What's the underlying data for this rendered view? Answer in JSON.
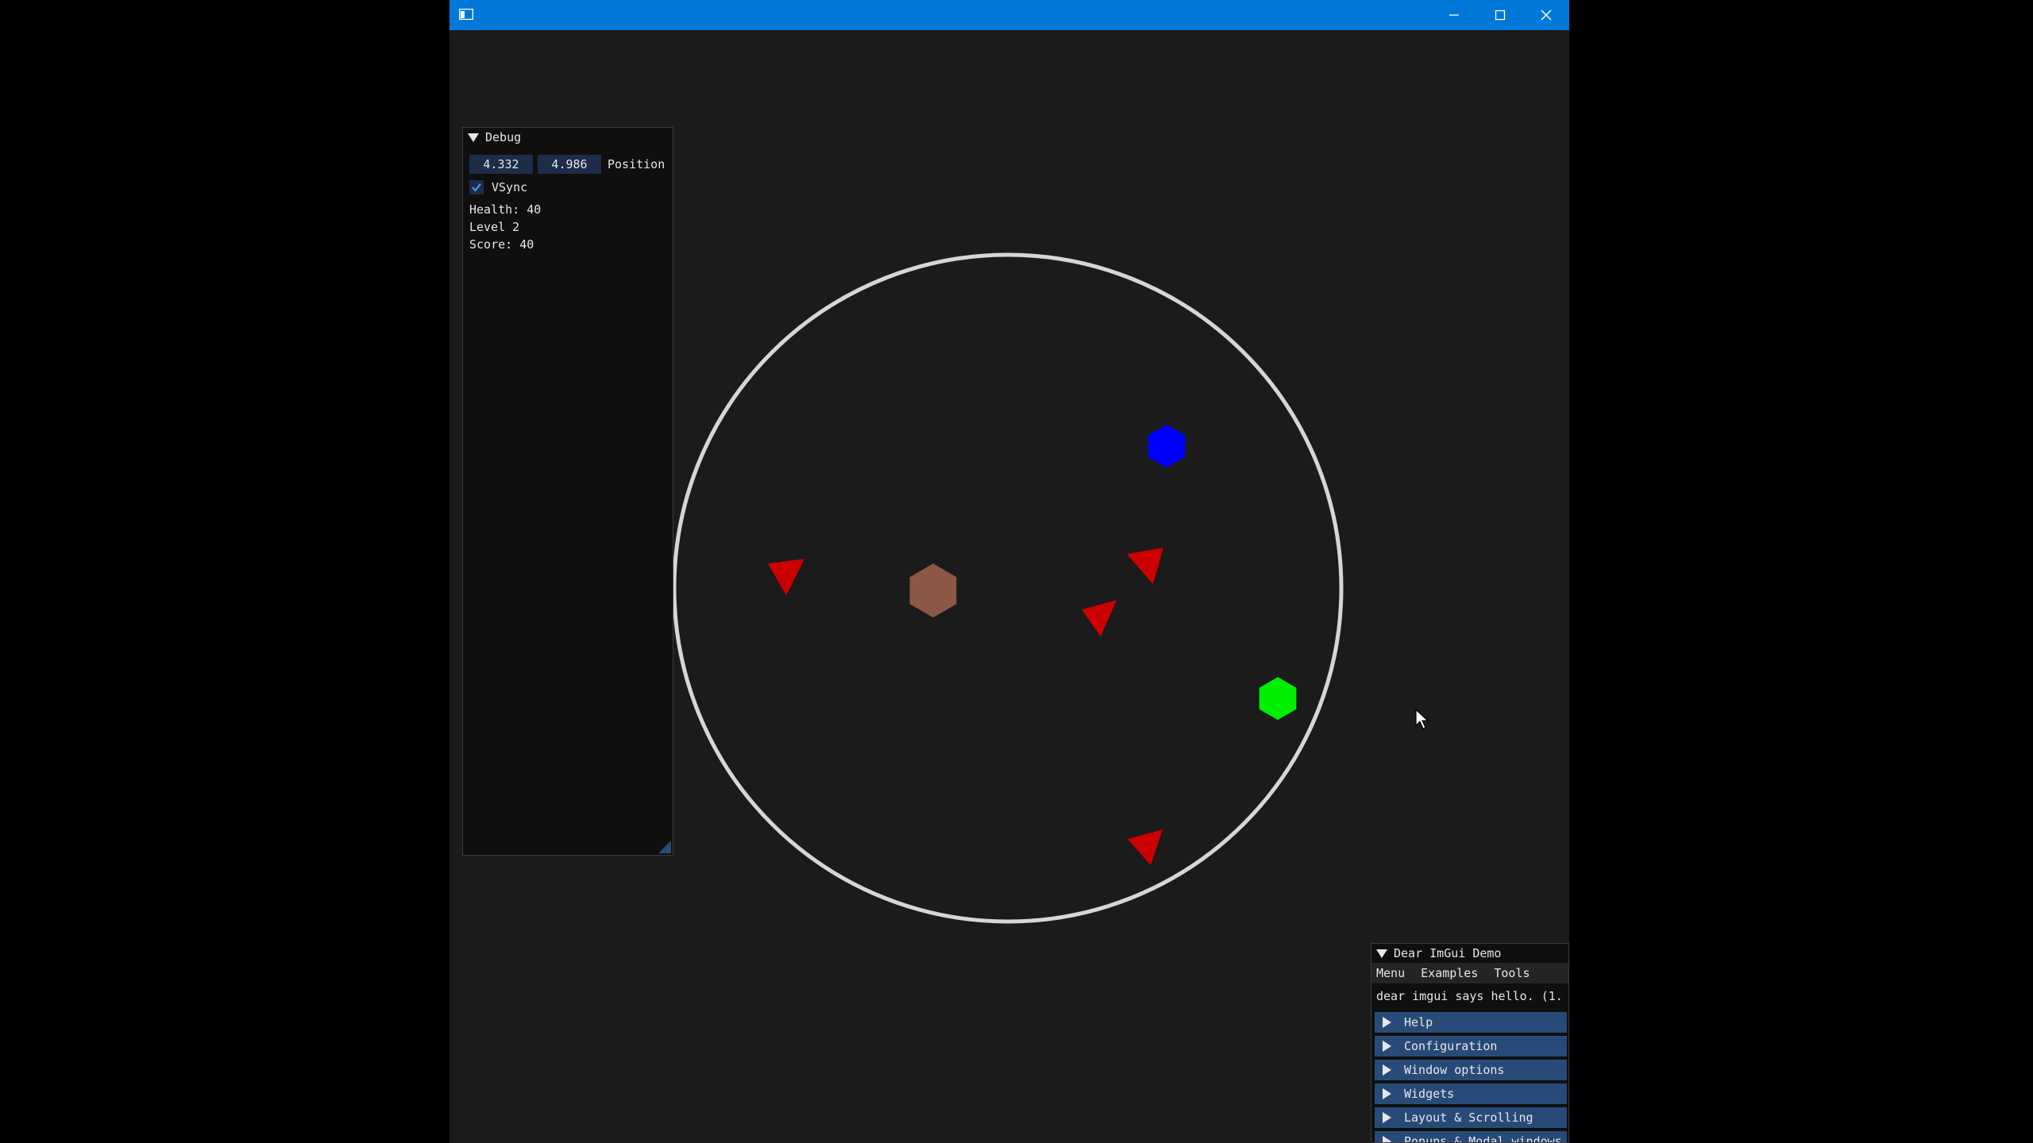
{
  "window": {
    "title": "",
    "titlebar_color": "#0078d7"
  },
  "scene": {
    "background": "#1b1b1b",
    "arena_ring_color": "#d6d6d6",
    "player": {
      "shape": "hexagon",
      "color": "#8a5845"
    },
    "pickups": [
      {
        "shape": "hexagon",
        "color": "#0000ff"
      },
      {
        "shape": "hexagon",
        "color": "#00ee00"
      }
    ],
    "enemies": [
      {
        "shape": "triangle",
        "color": "#cc0000"
      },
      {
        "shape": "triangle",
        "color": "#cc0000"
      },
      {
        "shape": "triangle",
        "color": "#cc0000"
      },
      {
        "shape": "triangle",
        "color": "#cc0000"
      }
    ]
  },
  "debug": {
    "title": "Debug",
    "position_x": "4.332",
    "position_y": "4.986",
    "position_label": "Position",
    "vsync_label": "VSync",
    "vsync_checked": true,
    "health": "Health: 40",
    "level": "Level 2",
    "score": "Score: 40"
  },
  "demo": {
    "title": "Dear ImGui Demo",
    "menu": [
      "Menu",
      "Examples",
      "Tools"
    ],
    "hello": "dear imgui says hello. (1.",
    "headers": [
      "Help",
      "Configuration",
      "Window options",
      "Widgets",
      "Layout & Scrolling",
      "Popups & Modal windows"
    ],
    "header_color": "#284a78"
  }
}
